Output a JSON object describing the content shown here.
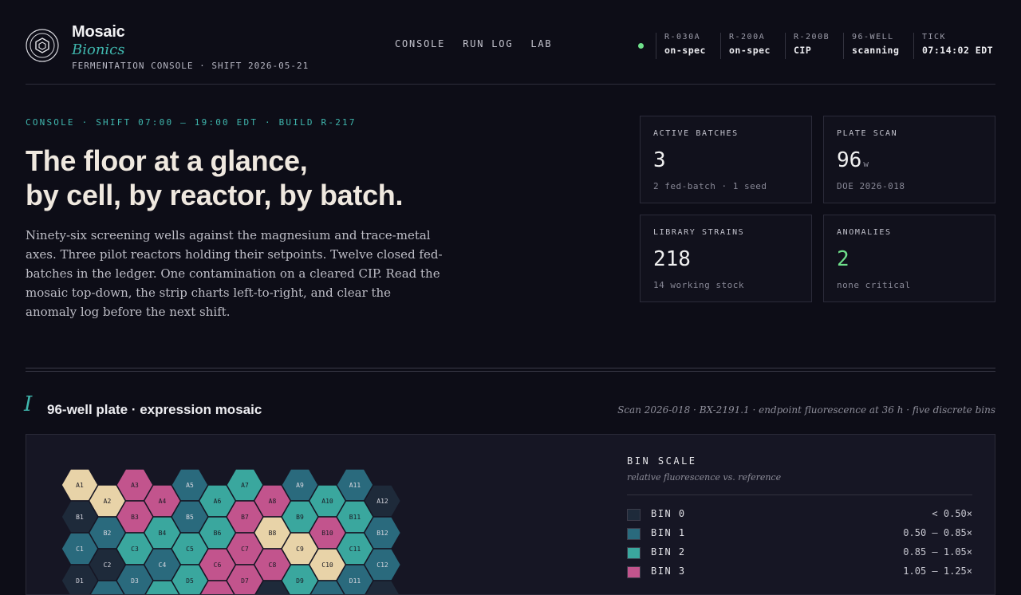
{
  "brand": {
    "name": "Mosaic",
    "sub": "Bionics",
    "meta": "FERMENTATION CONSOLE · SHIFT 2026-05-21"
  },
  "nav": [
    "CONSOLE",
    "RUN LOG",
    "LAB"
  ],
  "status": [
    {
      "key": "R-030A",
      "value": "on-spec"
    },
    {
      "key": "R-200A",
      "value": "on-spec"
    },
    {
      "key": "R-200B",
      "value": "CIP"
    },
    {
      "key": "96-WELL",
      "value": "scanning"
    },
    {
      "key": "TICK",
      "value": "07:14:02 EDT"
    }
  ],
  "colors": {
    "accent": "#3fb6ad",
    "ok": "#6fe08b",
    "bin0": "#1e2a3a",
    "bin1": "#2a6a7d",
    "bin2": "#3aa79e",
    "bin3": "#c2548d",
    "bin4": "#e8d3a8"
  },
  "intro": {
    "eyebrow": "CONSOLE · SHIFT 07:00 — 19:00 EDT · BUILD R-217",
    "headline1": "The floor at a glance,",
    "headline2": "by cell, by reactor, by batch.",
    "lede": "Ninety-six screening wells against the magnesium and trace-metal axes. Three pilot reactors holding their setpoints. Twelve closed fed-batches in the ledger. One contamination on a cleared CIP. Read the mosaic top-down, the strip charts left-to-right, and clear the anomaly log before the next shift."
  },
  "cards": {
    "active": {
      "label": "ACTIVE BATCHES",
      "value": "3",
      "sub": "2 fed-batch · 1 seed"
    },
    "plate": {
      "label": "PLATE SCAN",
      "value": "96",
      "unit": "w",
      "sub": "DOE 2026-018"
    },
    "strains": {
      "label": "LIBRARY STRAINS",
      "value": "218",
      "sub": "14 working stock"
    },
    "anomalies": {
      "label": "ANOMALIES",
      "value": "2",
      "sub": "none critical"
    }
  },
  "section": {
    "num": "I",
    "title": "96-well plate · expression mosaic",
    "meta": "Scan 2026-018 · BX-2191.1 · endpoint fluorescence at 36 h · five discrete bins"
  },
  "plate": {
    "rows": [
      {
        "row": "A",
        "bins": [
          4,
          4,
          3,
          3,
          1,
          2,
          2,
          3,
          1,
          2,
          1,
          0
        ]
      },
      {
        "row": "B",
        "bins": [
          0,
          1,
          3,
          2,
          1,
          2,
          3,
          4,
          2,
          3,
          2,
          1
        ]
      },
      {
        "row": "C",
        "bins": [
          1,
          0,
          2,
          1,
          2,
          3,
          3,
          3,
          4,
          4,
          2,
          1
        ]
      },
      {
        "row": "D",
        "bins": [
          0,
          1,
          1,
          2,
          2,
          3,
          3,
          0,
          2,
          1,
          1,
          0
        ]
      }
    ]
  },
  "bins": {
    "title": "BIN SCALE",
    "sub": "relative fluorescence vs. reference",
    "items": [
      {
        "label": "BIN 0",
        "range": "< 0.50×"
      },
      {
        "label": "BIN 1",
        "range": "0.50 — 0.85×"
      },
      {
        "label": "BIN 2",
        "range": "0.85 — 1.05×"
      },
      {
        "label": "BIN 3",
        "range": "1.05 — 1.25×"
      }
    ]
  }
}
